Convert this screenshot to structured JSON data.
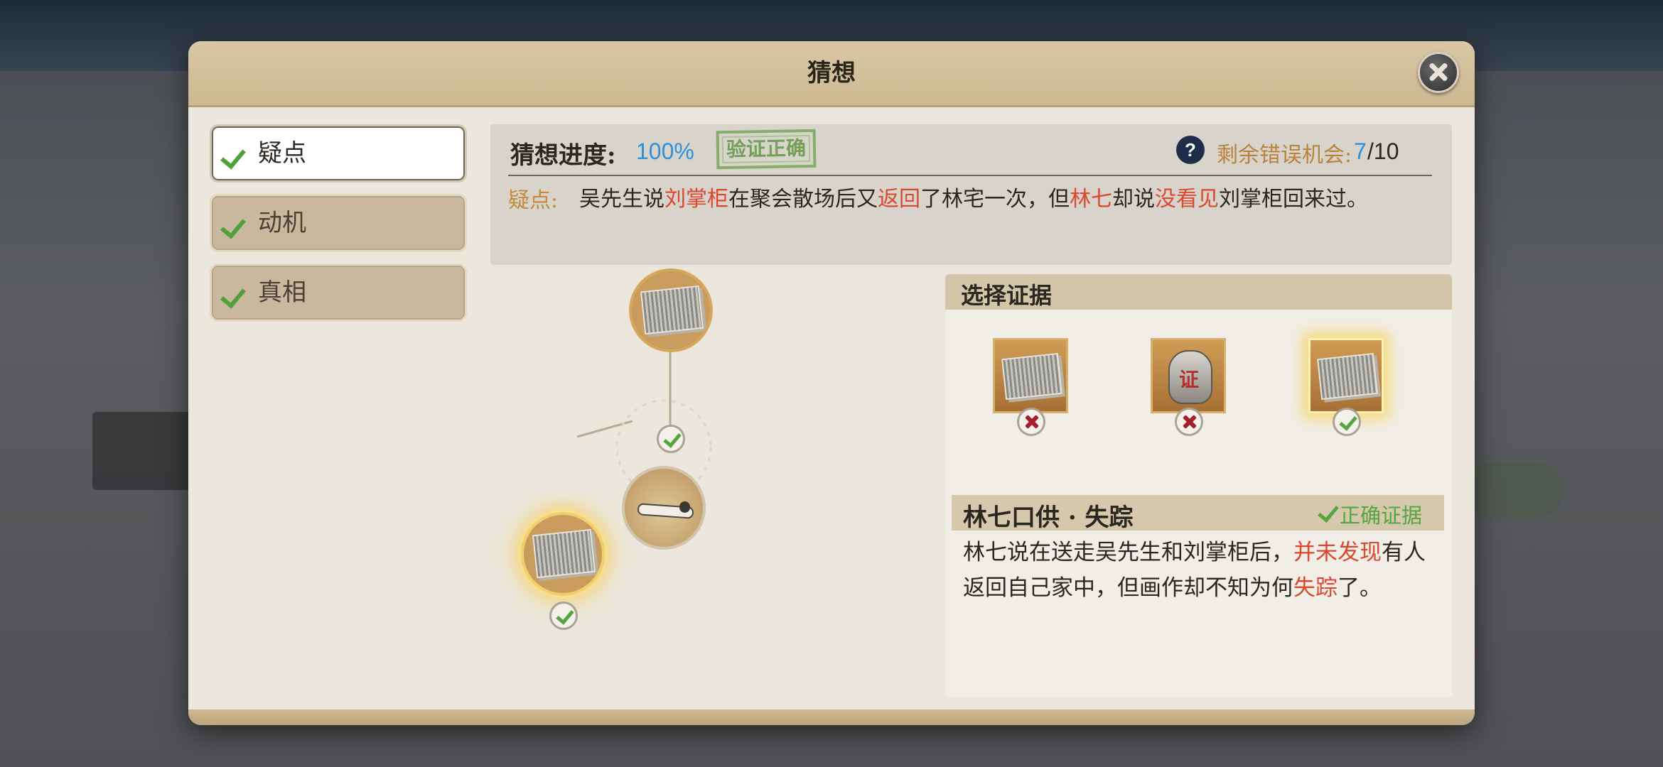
{
  "dialog": {
    "title": "猜想"
  },
  "tabs": [
    {
      "label": "疑点",
      "active": true
    },
    {
      "label": "动机",
      "active": false
    },
    {
      "label": "真相",
      "active": false
    }
  ],
  "progress": {
    "label": "猜想进度:",
    "value": "100%",
    "stamp": "验证正确"
  },
  "chances": {
    "label": "剩余错误机会:",
    "remaining": "7",
    "total": "/10"
  },
  "doubt": {
    "label": "疑点:",
    "segments": [
      {
        "text": "吴先生说",
        "highlight": false
      },
      {
        "text": "刘掌柜",
        "highlight": true
      },
      {
        "text": "在聚会散场后又",
        "highlight": false
      },
      {
        "text": "返回",
        "highlight": true
      },
      {
        "text": "了林宅一次，但",
        "highlight": false
      },
      {
        "text": "林七",
        "highlight": true
      },
      {
        "text": "却说",
        "highlight": false
      },
      {
        "text": "没看见",
        "highlight": true
      },
      {
        "text": "刘掌柜回来过。",
        "highlight": false
      }
    ]
  },
  "evidence": {
    "header": "选择证据",
    "items": [
      {
        "icon": "scroll-document-icon",
        "result": "wrong"
      },
      {
        "icon": "badge-icon",
        "char": "证",
        "result": "wrong"
      },
      {
        "icon": "scroll-document-icon",
        "result": "correct",
        "selected": true
      }
    ],
    "detail": {
      "title": "林七口供 · 失踪",
      "status": "正确证据",
      "segments": [
        {
          "text": "林七说在送走吴先生和刘掌柜后，",
          "highlight": false
        },
        {
          "text": "并未发现",
          "highlight": true
        },
        {
          "text": "有人返回自己家中，但画作却不知为何",
          "highlight": false
        },
        {
          "text": "失踪",
          "highlight": true
        },
        {
          "text": "了。",
          "highlight": false
        }
      ]
    }
  },
  "colors": {
    "accent_blue": "#2f8fd8",
    "highlight_red": "#d9482f",
    "correct_green": "#55a63e",
    "label_orange": "#b9823d"
  }
}
